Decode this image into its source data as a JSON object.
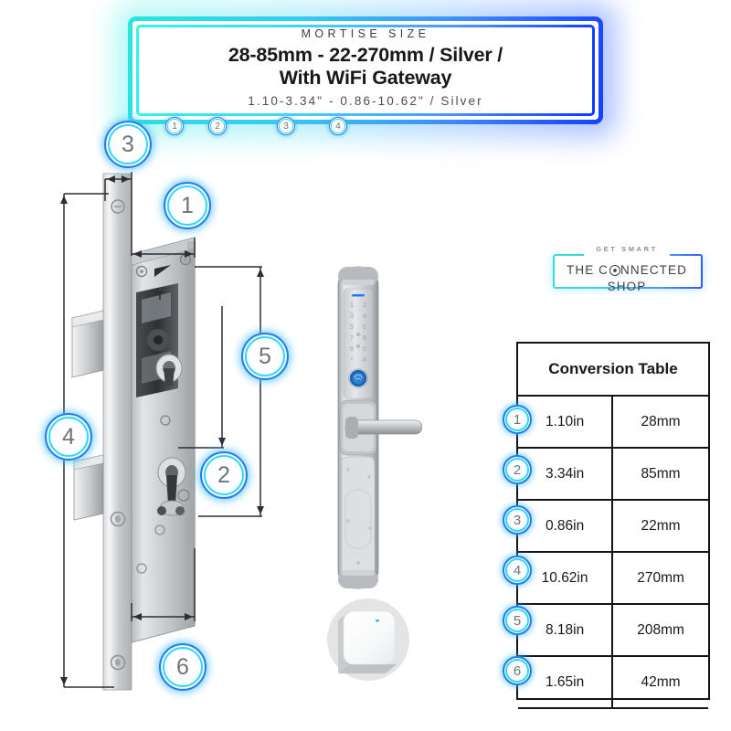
{
  "header": {
    "eyebrow": "MORTISE SIZE",
    "title_line1": "28-85mm - 22-270mm / Silver /",
    "title_line2": "With WiFi Gateway",
    "subtitle": "1.10-3.34\" - 0.86-10.62\" / Silver",
    "rail_badges": [
      "1",
      "2",
      "3",
      "4"
    ],
    "accent_cyan": "#2fd9ee",
    "accent_blue": "#1f7bf0"
  },
  "logo": {
    "eyebrow": "GET SMART",
    "word_before": "THE C",
    "word_after": "NNECTED SHOP",
    "icon": "globe-gear-icon"
  },
  "diagram": {
    "callouts": [
      {
        "id": "3",
        "label": "3"
      },
      {
        "id": "1",
        "label": "1"
      },
      {
        "id": "5",
        "label": "5"
      },
      {
        "id": "4",
        "label": "4"
      },
      {
        "id": "2",
        "label": "2"
      },
      {
        "id": "6",
        "label": "6"
      }
    ],
    "product_name": "mortise-lock-body",
    "door_lock_name": "smart-door-lock",
    "gateway_name": "wifi-gateway-hub",
    "keypad_digits": [
      "1",
      "2",
      "3",
      "4",
      "5",
      "6",
      "7",
      "8",
      "9",
      "0"
    ]
  },
  "table": {
    "title": "Conversion Table",
    "rows": [
      {
        "badge": "1",
        "inches": "1.10in",
        "mm": "28mm"
      },
      {
        "badge": "2",
        "inches": "3.34in",
        "mm": "85mm"
      },
      {
        "badge": "3",
        "inches": "0.86in",
        "mm": "22mm"
      },
      {
        "badge": "4",
        "inches": "10.62in",
        "mm": "270mm"
      },
      {
        "badge": "5",
        "inches": "8.18in",
        "mm": "208mm"
      },
      {
        "badge": "6",
        "inches": "1.65in",
        "mm": "42mm"
      }
    ]
  }
}
